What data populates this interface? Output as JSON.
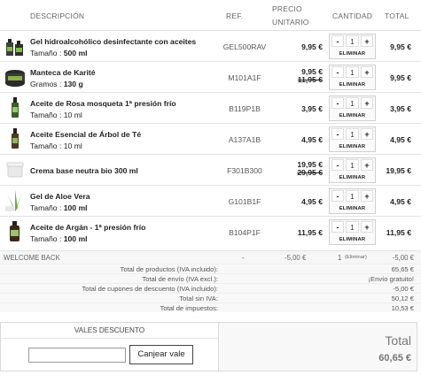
{
  "header": {
    "description": "DESCRIPCIÓN",
    "ref": "REF.",
    "price_line1": "PRECIO",
    "price_line2": "UNITARIO",
    "quantity": "CANTIDAD",
    "total": "TOTAL"
  },
  "products": [
    {
      "name": "Gel hidroalcohólico desinfectante con aceites",
      "attr_label": "Tamaño :",
      "attr_value": "500 ml",
      "attr_bold": true,
      "ref": "GEL500RAV",
      "price": "9,95 €",
      "old_price": "",
      "qty": "1",
      "remove": "ELIMINAR",
      "total": "9,95 €",
      "thumb": "hand-sanitizer-bottles"
    },
    {
      "name": "Manteca de Karité",
      "attr_label": "Gramos :",
      "attr_value": "130 g",
      "attr_bold": true,
      "ref": "M101A1F",
      "price": "9,95 €",
      "old_price": "11,95 €",
      "qty": "1",
      "remove": "ELIMINAR",
      "total": "9,95 €",
      "thumb": "shea-butter-jar"
    },
    {
      "name": "Aceite de Rosa mosqueta 1ª presión frío",
      "attr_label": "Tamaño :",
      "attr_value": "10 ml",
      "attr_bold": false,
      "ref": "B119P1B",
      "price": "3,95 €",
      "old_price": "",
      "qty": "1",
      "remove": "ELIMINAR",
      "total": "3,95 €",
      "thumb": "dropper-bottle"
    },
    {
      "name": "Aceite Esencial de Árbol de Té",
      "attr_label": "Tamaño :",
      "attr_value": "10 ml",
      "attr_bold": false,
      "ref": "A137A1B",
      "price": "4,95 €",
      "old_price": "",
      "qty": "1",
      "remove": "ELIMINAR",
      "total": "4,95 €",
      "thumb": "dropper-bottle"
    },
    {
      "name": "Crema base neutra bio 300 ml",
      "attr_label": "",
      "attr_value": "",
      "attr_bold": false,
      "ref": "F301B300",
      "price": "19,95 €",
      "old_price": "29,95 €",
      "qty": "1",
      "remove": "ELIMINAR",
      "total": "19,95 €",
      "thumb": "cream-jar"
    },
    {
      "name": "Gel de Aloe Vera",
      "attr_label": "Tamaño :",
      "attr_value": "100 ml",
      "attr_bold": true,
      "ref": "G101B1F",
      "price": "4,95 €",
      "old_price": "",
      "qty": "1",
      "remove": "ELIMINAR",
      "total": "4,95 €",
      "thumb": "aloe-vera-plant"
    },
    {
      "name": "Aceite de Argán - 1ª presión frío",
      "attr_label": "Tamaño :",
      "attr_value": "100 ml",
      "attr_bold": true,
      "ref": "B104P1F",
      "price": "11,95 €",
      "old_price": "",
      "qty": "1",
      "remove": "ELIMINAR",
      "total": "11,95 €",
      "thumb": "argan-oil-bottle"
    }
  ],
  "voucher_row": {
    "name": "WELCOME BACK",
    "ref": "-",
    "price": "-5,00 €",
    "qty": "1",
    "remove": "(Eliminar)",
    "total": "-5,00 €"
  },
  "summary": [
    {
      "label": "Total de productos (IVA incluido):",
      "value": "65,65 €"
    },
    {
      "label": "Total de envío (IVA excl.):",
      "value": "¡Envío gratuito!"
    },
    {
      "label": "Total de cupones de descuento (IVA incluido):",
      "value": "-5,00 €"
    },
    {
      "label": "Total sin IVA:",
      "value": "50,12 €"
    },
    {
      "label": "Total de impuestos:",
      "value": "10,53 €"
    }
  ],
  "vales": {
    "title": "VALES DESCUENTO",
    "input_value": "",
    "button": "Canjear vale"
  },
  "grand_total": {
    "label": "Total",
    "value": "60,65 €"
  }
}
